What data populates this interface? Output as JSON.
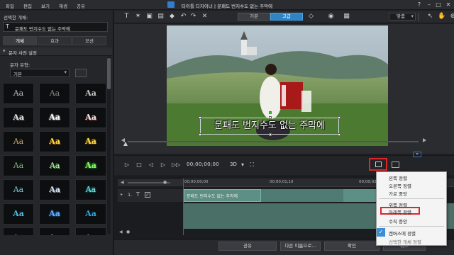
{
  "menubar": {
    "items": [
      "파일",
      "편집",
      "보기",
      "재생",
      "공유"
    ],
    "title": "타이틀 디자이너 | 문패도 번지수도 없는 주막에"
  },
  "left": {
    "selected_label": "선택한 개체:",
    "selected_value": "문패도 번지수도 없는 주막에",
    "tabs": [
      "개체",
      "효과",
      "모션"
    ],
    "section": "문자 사전 설정",
    "type_label": "문자 유형:",
    "type_value": "기본",
    "preset_text": "Aa"
  },
  "toolbar": {
    "mode_basic": "기본",
    "mode_advanced": "고급",
    "fit_value": "맞춤"
  },
  "preview": {
    "subtitle": "문패도 번지수도 없는 주막에"
  },
  "playback": {
    "timecode": "00;00;00;00",
    "quality": "3D"
  },
  "timeline": {
    "track": "1.",
    "clip": "문패도 번지수도 없는 주막에",
    "ruler": [
      "00;00;00;00",
      "00;00;01;10",
      "00;00;02;20"
    ]
  },
  "bottom": {
    "share": "공유",
    "save_as": "다른 이름으로...",
    "ok": "확인",
    "cancel": "취소"
  },
  "context_menu": {
    "items": [
      "왼쪽 정렬",
      "오른쪽 정렬",
      "가로 중앙",
      "위쪽 정렬",
      "아래쪽 정렬",
      "수직 중앙",
      "캔버스에 정렬",
      "선택한 개체 정렬"
    ],
    "highlighted": "아래쪽 정렬",
    "checked": "캔버스에 정렬"
  },
  "colors": {
    "accent": "#2f84c6",
    "highlight_red": "#e02626",
    "clip": "#5e8f84"
  }
}
